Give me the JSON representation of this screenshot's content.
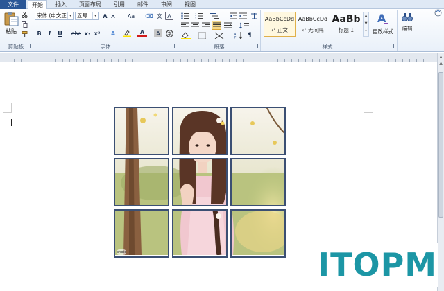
{
  "tabs": [
    {
      "label": "文件"
    },
    {
      "label": "开始"
    },
    {
      "label": "插入"
    },
    {
      "label": "页面布局"
    },
    {
      "label": "引用"
    },
    {
      "label": "邮件"
    },
    {
      "label": "审阅"
    },
    {
      "label": "视图"
    }
  ],
  "clipboard": {
    "paste_label": "粘贴",
    "group_label": "剪贴板"
  },
  "font": {
    "family_value": "宋体 (中文正)",
    "size_value": "五号",
    "grow_label": "A",
    "shrink_label": "A",
    "case_label": "Aa",
    "bold": "B",
    "italic": "I",
    "underline": "U",
    "strike": "abe",
    "subscript": "x₂",
    "superscript": "x²",
    "effects": "A",
    "font_color": "A",
    "char_border": "A",
    "group_label": "字体"
  },
  "paragraph": {
    "group_label": "段落"
  },
  "styles": {
    "items": [
      {
        "sample": "AaBbCcDd",
        "name": "↵ 正文"
      },
      {
        "sample": "AaBbCcDd",
        "name": "↵ 无间隔"
      },
      {
        "sample": "AaBb",
        "name": "标题 1"
      }
    ],
    "change_styles_label": "更改样式",
    "group_label": "样式"
  },
  "editing": {
    "label": "编辑"
  },
  "photo": {
    "badge": "photo"
  },
  "logo": {
    "text": "ITOPM"
  },
  "colors": {
    "accent": "#2b5797",
    "logo": "#1c96a5",
    "cell_border": "#3b4f73"
  }
}
